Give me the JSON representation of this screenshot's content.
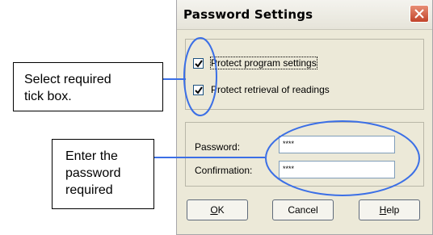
{
  "dialog": {
    "title": "Password Settings",
    "checkboxes": [
      {
        "label": "Protect program settings",
        "checked": true
      },
      {
        "label": "Protect retrieval of readings",
        "checked": true
      }
    ],
    "password_label": "Password:",
    "password_value": "****",
    "confirmation_label": "Confirmation:",
    "confirmation_value": "****",
    "buttons": {
      "ok": "OK",
      "cancel": "Cancel",
      "help": "Help"
    }
  },
  "callouts": {
    "tick_box": {
      "line1": "Select required",
      "line2": "tick box."
    },
    "password": {
      "line1": "Enter the",
      "line2": "password",
      "line3": "required"
    }
  },
  "colors": {
    "annotation_blue": "#3b6fe6",
    "dialog_bg": "#ece9d8",
    "close_red": "#c1432a"
  }
}
